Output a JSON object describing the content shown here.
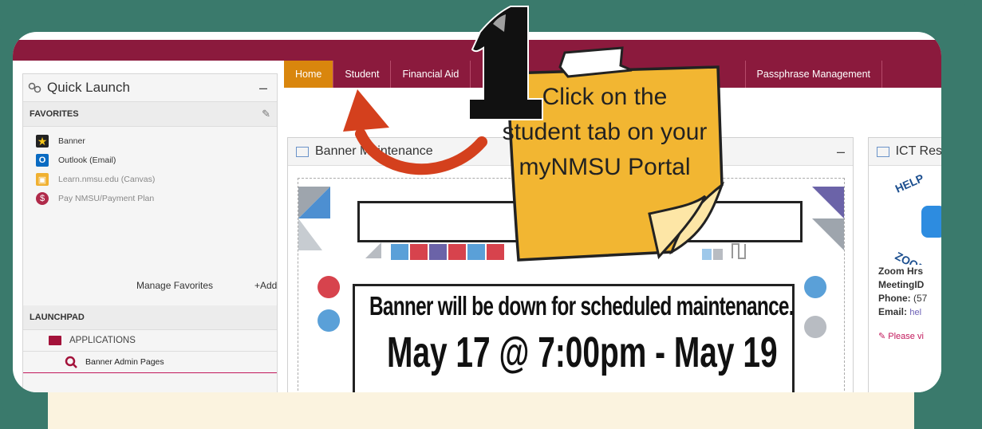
{
  "tabs": [
    {
      "label": "Home",
      "active": true
    },
    {
      "label": "Student",
      "active": false
    },
    {
      "label": "Financial Aid",
      "active": false
    }
  ],
  "tab_passphrase": "Passphrase Management",
  "quick_launch": {
    "title": "Quick Launch",
    "collapse": "–",
    "favorites_heading": "FAVORITES",
    "favorites": [
      {
        "label": "Banner",
        "icon": "star-icon"
      },
      {
        "label": "Outlook (Email)",
        "icon": "outlook-icon"
      },
      {
        "label": "Learn.nmsu.edu (Canvas)",
        "icon": "book-icon"
      },
      {
        "label": "Pay NMSU/Payment Plan",
        "icon": "payment-icon"
      }
    ],
    "manage_favorites": "Manage Favorites",
    "add": "+Add",
    "launchpad_heading": "LAUNCHPAD",
    "applications": "APPLICATIONS",
    "banner_admin": "Banner Admin Pages"
  },
  "banner_panel": {
    "title": "Banner Maintenance",
    "collapse": "–",
    "poster_top": "DO",
    "poster_line1": "Banner will be down for scheduled maintenance.",
    "poster_line2": "May 17 @ 7:00pm - May 19"
  },
  "ict_panel": {
    "title": "ICT Res",
    "badge_top": "HELP",
    "badge_bottom": "ZOOM R",
    "zoom_hrs": "Zoom Hrs",
    "meeting_id": "MeetingID",
    "phone_label": "Phone:",
    "phone_value": "(57",
    "email_label": "Email:",
    "email_value": "hel",
    "please_visit": "Please vi"
  },
  "annotation": {
    "step_number": "1",
    "text": "Click on the student tab on your myNMSU Portal"
  },
  "colors": {
    "frame": "#3a7a6c",
    "maroon": "#8b1a3d",
    "tab_active": "#d9860d",
    "note": "#f2b632",
    "arrow": "#d4401d"
  }
}
